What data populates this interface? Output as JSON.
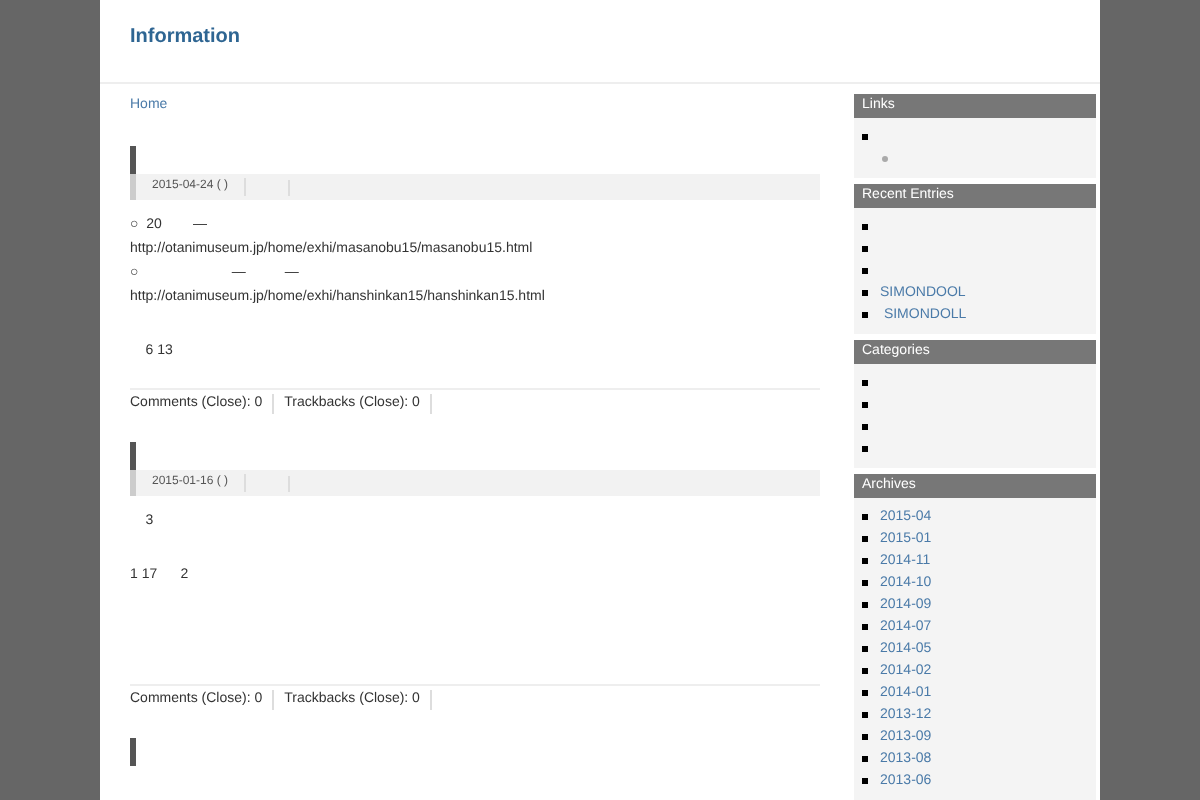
{
  "site": {
    "title": "Information"
  },
  "breadcrumb": "Home",
  "posts": [
    {
      "kind": "full",
      "date": "2015-04-24 ( )",
      "paragraphs": [
        [
          "○  20        —",
          "http://otanimuseum.jp/home/exhi/masanobu15/masanobu15.html",
          "○                        —          —",
          "http://otanimuseum.jp/home/exhi/hanshinkan15/hanshinkan15.html"
        ],
        [
          "    6 13"
        ]
      ],
      "comments": "Comments (Close): 0",
      "trackbacks": "Trackbacks (Close): 0"
    },
    {
      "kind": "full",
      "date": "2015-01-16 ( )",
      "paragraphs": [
        [
          "    3"
        ],
        [
          "1 17      2"
        ]
      ],
      "comments": "Comments (Close): 0",
      "trackbacks": "Trackbacks (Close): 0"
    },
    {
      "kind": "title_only"
    }
  ],
  "sidebar": [
    {
      "title": "Links",
      "items": [
        {
          "kind": "blank",
          "children": [
            {
              "kind": "blank"
            }
          ]
        }
      ]
    },
    {
      "title": "Recent Entries",
      "items": [
        {
          "kind": "blank"
        },
        {
          "kind": "blank"
        },
        {
          "kind": "blank"
        },
        {
          "kind": "link",
          "text": "SIMONDOOL"
        },
        {
          "kind": "link",
          "text": " SIMONDOLL"
        }
      ]
    },
    {
      "title": "Categories",
      "items": [
        {
          "kind": "blank"
        },
        {
          "kind": "blank"
        },
        {
          "kind": "blank"
        },
        {
          "kind": "blank"
        }
      ]
    },
    {
      "title": "Archives",
      "items": [
        {
          "kind": "link",
          "text": "2015-04"
        },
        {
          "kind": "link",
          "text": "2015-01"
        },
        {
          "kind": "link",
          "text": "2014-11"
        },
        {
          "kind": "link",
          "text": "2014-10"
        },
        {
          "kind": "link",
          "text": "2014-09"
        },
        {
          "kind": "link",
          "text": "2014-07"
        },
        {
          "kind": "link",
          "text": "2014-05"
        },
        {
          "kind": "link",
          "text": "2014-02"
        },
        {
          "kind": "link",
          "text": "2014-01"
        },
        {
          "kind": "link",
          "text": "2013-12"
        },
        {
          "kind": "link",
          "text": "2013-09"
        },
        {
          "kind": "link",
          "text": "2013-08"
        },
        {
          "kind": "link",
          "text": "2013-06"
        }
      ]
    }
  ]
}
